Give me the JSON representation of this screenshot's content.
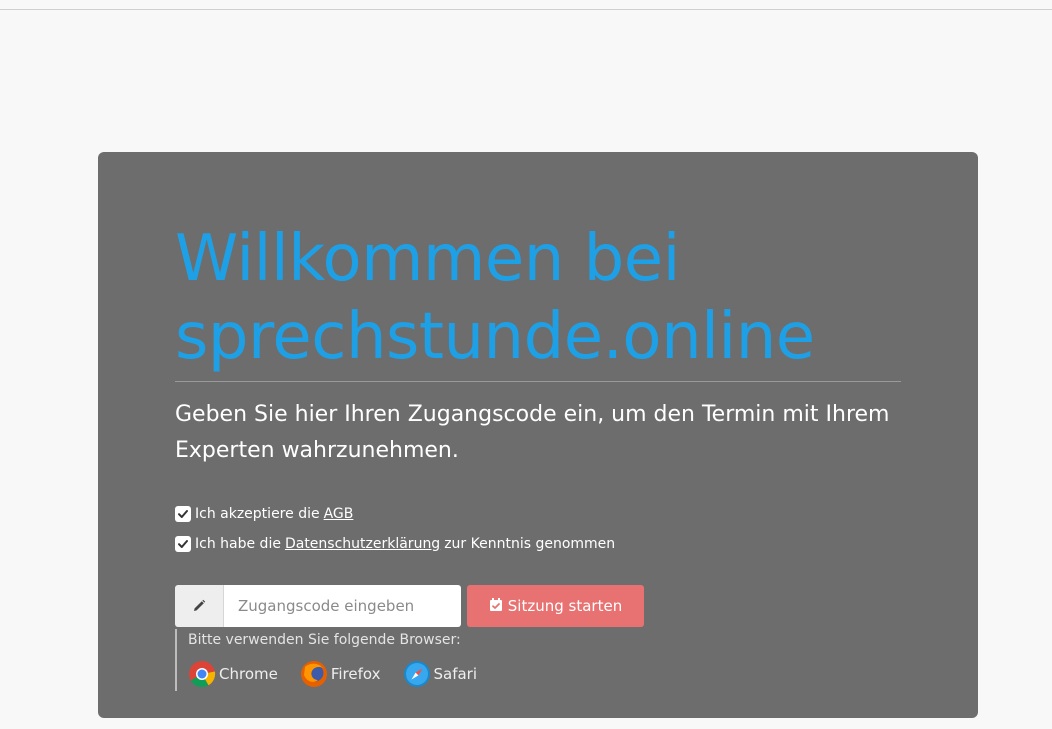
{
  "welcome": {
    "title_line1": "Willkommen bei",
    "title_line2": "sprechstunde.online",
    "intro": "Geben Sie hier Ihren Zugangscode ein, um den Termin mit Ihrem Experten wahrzunehmen."
  },
  "consents": {
    "agb": {
      "prefix": "Ich akzeptiere die",
      "link": "AGB",
      "checked": true
    },
    "privacy": {
      "prefix": "Ich habe die",
      "link": "Datenschutzerklärung",
      "suffix": "zur Kenntnis genommen",
      "checked": true
    }
  },
  "access": {
    "input_icon": "pencil-icon",
    "placeholder": "Zugangscode eingeben",
    "value": "",
    "button_icon": "calendar-check-icon",
    "button_label": "Sitzung starten"
  },
  "browsers": {
    "hint": "Bitte verwenden Sie folgende Browser:",
    "items": [
      {
        "label": "Chrome",
        "icon": "chrome-icon"
      },
      {
        "label": "Firefox",
        "icon": "firefox-icon"
      },
      {
        "label": "Safari",
        "icon": "safari-icon"
      }
    ]
  },
  "colors": {
    "page_background": "#f8f8f8",
    "card_background": "#6d6d6d",
    "headline": "#1ea0e6",
    "button": "#e87272",
    "text": "#ffffff"
  }
}
